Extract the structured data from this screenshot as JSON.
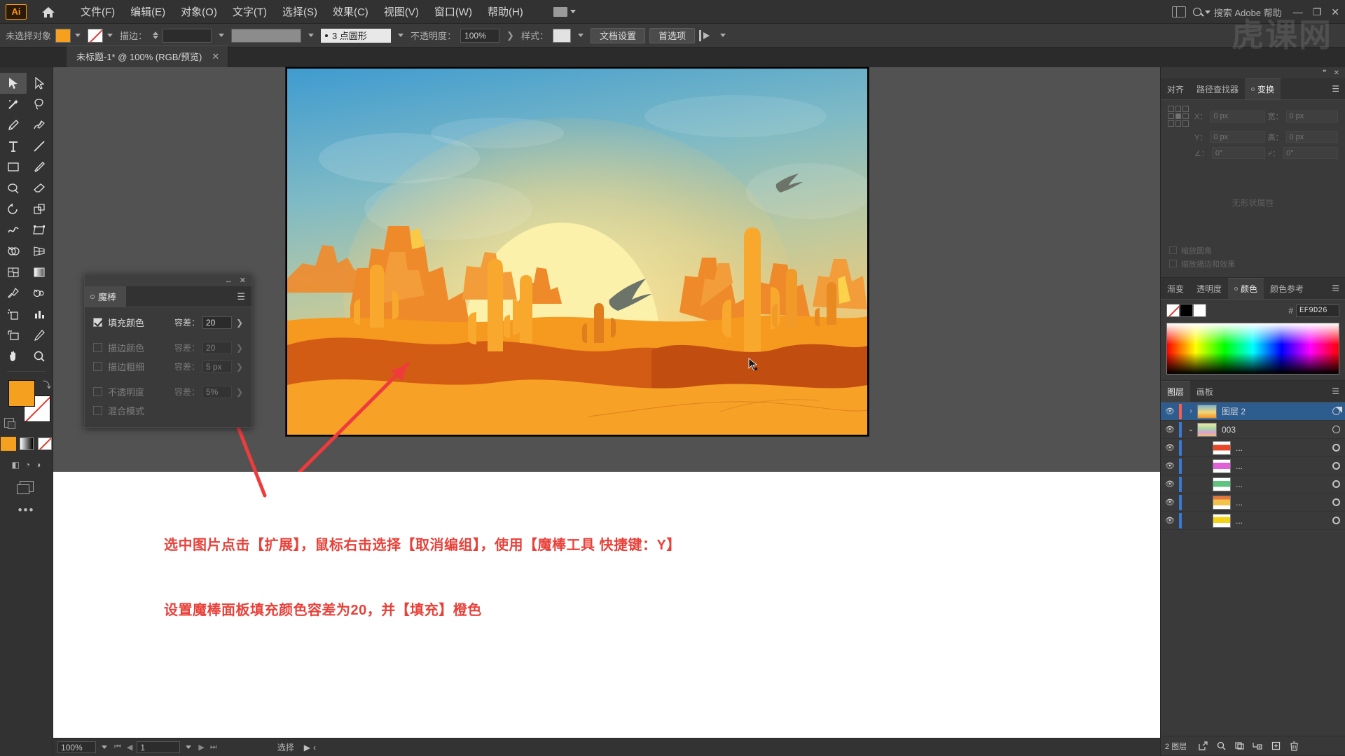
{
  "app": {
    "logo": "Ai",
    "watermark": "虎课网"
  },
  "menubar": {
    "items": [
      "文件(F)",
      "编辑(E)",
      "对象(O)",
      "文字(T)",
      "选择(S)",
      "效果(C)",
      "视图(V)",
      "窗口(W)",
      "帮助(H)"
    ],
    "search_placeholder": "搜索 Adobe 帮助",
    "window_controls": [
      "—",
      "❐",
      "✕"
    ]
  },
  "controlbar": {
    "selection_status": "未选择对象",
    "stroke_label": "描边：",
    "stroke_weight": "",
    "brush_label": "3 点圆形",
    "opacity_label": "不透明度：",
    "opacity_value": "100%",
    "style_label": "样式：",
    "doc_setup_button": "文档设置",
    "preferences_button": "首选项"
  },
  "document_tab": {
    "title": "未标题-1* @ 100% (RGB/预览)",
    "close": "✕"
  },
  "toolbar": {
    "tools": [
      "selection-tool",
      "direct-selection-tool",
      "magic-wand-tool",
      "lasso-tool",
      "pen-tool",
      "curvature-tool",
      "type-tool",
      "line-segment-tool",
      "rectangle-tool",
      "paintbrush-tool",
      "shaper-tool",
      "eraser-tool",
      "rotate-tool",
      "scale-tool",
      "width-tool",
      "free-transform-tool",
      "shape-builder-tool",
      "perspective-grid-tool",
      "mesh-tool",
      "gradient-tool",
      "eyedropper-tool",
      "blend-tool",
      "symbol-sprayer-tool",
      "column-graph-tool",
      "artboard-tool",
      "slice-tool",
      "hand-tool",
      "zoom-tool"
    ],
    "fill_color": "#f5a01f",
    "stroke_color": "none",
    "more_tools": "•••"
  },
  "magic_wand_panel": {
    "tab_title": "魔棒",
    "menu_icon": "☰",
    "collapse_icon": "↔",
    "close_icon": "✕",
    "rows": [
      {
        "label": "填充颜色",
        "checked": true,
        "tolerance_label": "容差：",
        "tolerance_value": "20",
        "dim": false
      },
      {
        "label": "描边颜色",
        "checked": false,
        "tolerance_label": "容差：",
        "tolerance_value": "20",
        "dim": true
      },
      {
        "label": "描边粗细",
        "checked": false,
        "tolerance_label": "容差：",
        "tolerance_value": "5 px",
        "dim": true
      },
      {
        "label": "不透明度",
        "checked": false,
        "tolerance_label": "容差：",
        "tolerance_value": "5%",
        "dim": true
      },
      {
        "label": "混合模式",
        "checked": false,
        "tolerance_label": "",
        "tolerance_value": "",
        "dim": true
      }
    ]
  },
  "transform_panel": {
    "tabs": [
      "对齐",
      "路径查找器",
      "变换"
    ],
    "active_tab": "变换",
    "fields": [
      {
        "label": "X：",
        "value": "0 px"
      },
      {
        "label": "宽：",
        "value": "0 px"
      },
      {
        "label": "Y：",
        "value": "0 px"
      },
      {
        "label": "高：",
        "value": "0 px"
      }
    ],
    "angle_label": "∠：",
    "angle_value": "0°",
    "shear_label": "⌿：",
    "shear_value": "0°",
    "empty_note": "无形状属性",
    "checkboxes": [
      "缩放圆角",
      "缩放描边和效果"
    ]
  },
  "color_panel": {
    "tabs": [
      "渐变",
      "透明度",
      "颜色",
      "颜色参考"
    ],
    "active_tab": "颜色",
    "hash": "#",
    "hex_value": "EF9D26",
    "swatches": [
      "none",
      "#000000",
      "#ffffff"
    ]
  },
  "layers_panel": {
    "tabs": [
      "图层",
      "画板"
    ],
    "active_tab": "图层",
    "rows": [
      {
        "name": "图层 2",
        "selected": true,
        "indent": 0,
        "has_arrow": true,
        "arrow": "›",
        "color": "#ff5a4d",
        "thumb": "artwork"
      },
      {
        "name": "003",
        "selected": false,
        "indent": 0,
        "has_arrow": true,
        "arrow": "⌄",
        "color": "#3a78d6",
        "thumb": "group"
      },
      {
        "name": "...",
        "selected": false,
        "indent": 1,
        "has_arrow": false,
        "arrow": "",
        "color": "#3a78d6",
        "thumb": "orange"
      },
      {
        "name": "...",
        "selected": false,
        "indent": 1,
        "has_arrow": false,
        "arrow": "",
        "color": "#3a78d6",
        "thumb": "magenta"
      },
      {
        "name": "...",
        "selected": false,
        "indent": 1,
        "has_arrow": false,
        "arrow": "",
        "color": "#3a78d6",
        "thumb": "green"
      },
      {
        "name": "...",
        "selected": false,
        "indent": 1,
        "has_arrow": false,
        "arrow": "",
        "color": "#3a78d6",
        "thumb": "amber"
      },
      {
        "name": "...",
        "selected": false,
        "indent": 1,
        "has_arrow": false,
        "arrow": "",
        "color": "#3a78d6",
        "thumb": "yellow"
      }
    ],
    "footer_count": "2 图层",
    "footer_icons": [
      "release-to-layers-icon",
      "locate-object-icon",
      "make-clipping-mask-icon",
      "create-sublayer-icon",
      "create-new-layer-icon",
      "delete-selection-icon"
    ]
  },
  "statusbar": {
    "zoom": "100%",
    "page": "1",
    "status_text": "选择"
  },
  "caption": {
    "line1": "选中图片点击【扩展】，鼠标右击选择【取消编组】，使用【魔棒工具 快捷键：Y】",
    "line2": "设置魔棒面板填充颜色容差为20，并【填充】橙色",
    "color": "#e8413a"
  },
  "artwork": {
    "description": "desert-sunset-illustration",
    "sky_top": "#4ba3d3",
    "sky_mid": "#9ec6b9",
    "sun": "#faf0a8",
    "sand": "#f8a22a",
    "dune_dark": "#c94f15"
  }
}
